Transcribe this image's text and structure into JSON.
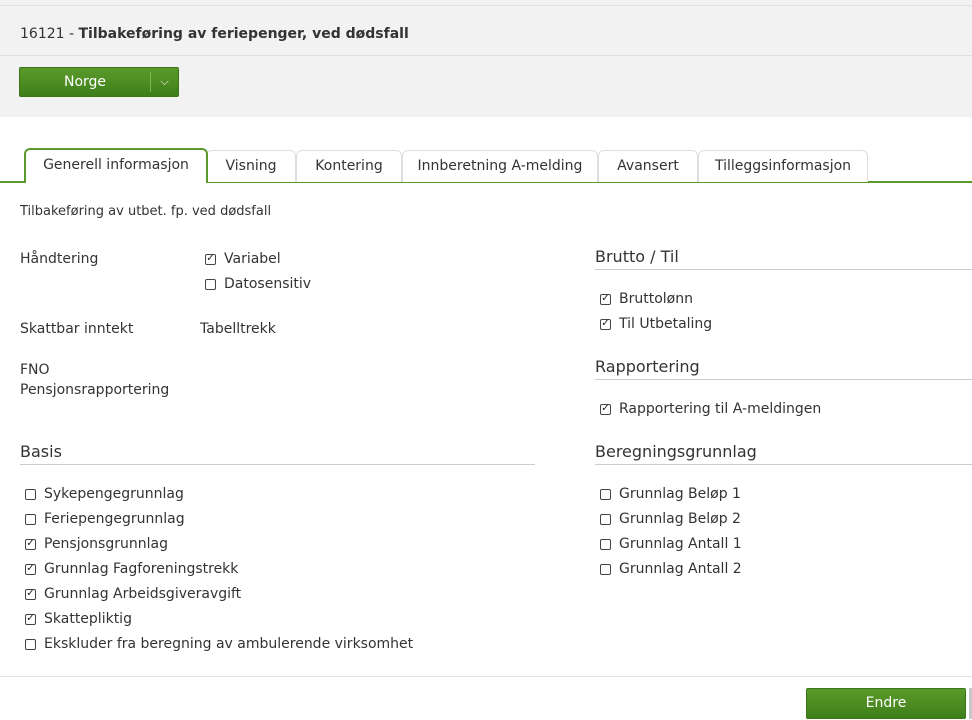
{
  "header": {
    "code": "16121",
    "separator": " - ",
    "name": "Tilbakeføring av feriepenger, ved dødsfall",
    "country_button": "Norge",
    "country_chevron": "⌵"
  },
  "tabs": [
    {
      "label": "Generell informasjon",
      "active": true
    },
    {
      "label": "Visning"
    },
    {
      "label": "Kontering"
    },
    {
      "label": "Innberetning A-melding"
    },
    {
      "label": "Avansert"
    },
    {
      "label": "Tilleggsinformasjon"
    }
  ],
  "general": {
    "description": "Tilbakeføring av utbet. fp. ved dødsfall",
    "handling_label": "Håndtering",
    "handling_options": [
      {
        "label": "Variabel",
        "checked": true
      },
      {
        "label": "Datosensitiv",
        "checked": false
      }
    ],
    "taxable_label": "Skattbar inntekt",
    "taxable_value": "Tabelltrekk",
    "fno_label": "FNO",
    "pension_label": "Pensjonsrapportering"
  },
  "basis": {
    "title": "Basis",
    "items": [
      {
        "label": "Sykepengegrunnlag",
        "checked": false
      },
      {
        "label": "Feriepengegrunnlag",
        "checked": false
      },
      {
        "label": "Pensjonsgrunnlag",
        "checked": true
      },
      {
        "label": "Grunnlag Fagforeningstrekk",
        "checked": true
      },
      {
        "label": "Grunnlag Arbeidsgiveravgift",
        "checked": true
      },
      {
        "label": "Skattepliktig",
        "checked": true
      },
      {
        "label": "Ekskluder fra beregning av ambulerende virksomhet",
        "checked": false
      }
    ]
  },
  "gross": {
    "title": "Brutto / Til",
    "items": [
      {
        "label": "Bruttolønn",
        "checked": true
      },
      {
        "label": "Til Utbetaling",
        "checked": true
      }
    ]
  },
  "reporting": {
    "title": "Rapportering",
    "items": [
      {
        "label": "Rapportering til A-meldingen",
        "checked": true
      }
    ]
  },
  "calc_basis": {
    "title": "Beregningsgrunnlag",
    "items": [
      {
        "label": "Grunnlag Beløp 1",
        "checked": false
      },
      {
        "label": "Grunnlag Beløp 2",
        "checked": false
      },
      {
        "label": "Grunnlag Antall 1",
        "checked": false
      },
      {
        "label": "Grunnlag Antall 2",
        "checked": false
      }
    ]
  },
  "footer": {
    "edit_button": "Endre"
  },
  "colors": {
    "accent": "#4a8a22",
    "header_bg": "#f2f2f2"
  }
}
